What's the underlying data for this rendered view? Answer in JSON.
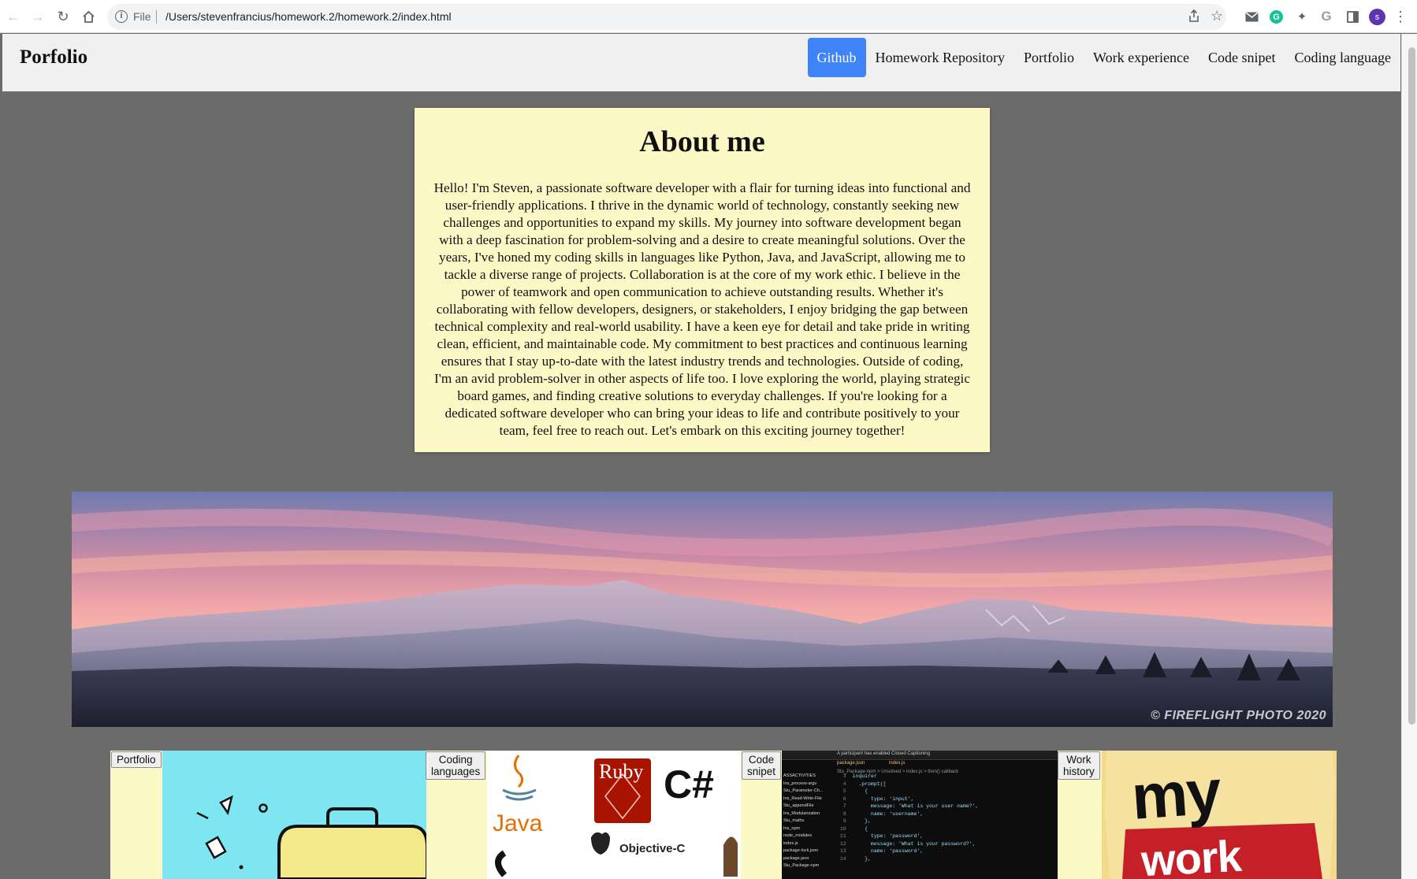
{
  "browser": {
    "file_label": "File",
    "url": "/Users/stevenfrancius/homework.2/homework.2/index.html",
    "avatar_letter": "s",
    "icons": [
      "back-arrow-icon",
      "forward-arrow-icon",
      "reload-icon",
      "home-icon",
      "info-icon",
      "share-icon",
      "star-icon",
      "mail-icon",
      "grammarly-icon",
      "puzzle-icon",
      "google-icon",
      "sidebar-icon",
      "menu-dots-icon"
    ]
  },
  "header": {
    "brand": "Porfolio",
    "nav": [
      {
        "label": "Github",
        "active": true
      },
      {
        "label": "Homework Repository",
        "active": false
      },
      {
        "label": "Portfolio",
        "active": false
      },
      {
        "label": "Work experience",
        "active": false
      },
      {
        "label": "Code snipet",
        "active": false
      },
      {
        "label": "Coding language",
        "active": false
      }
    ],
    "active_color": "#3f83f8"
  },
  "about": {
    "title": "About me",
    "body": "Hello! I'm Steven, a passionate software developer with a flair for turning ideas into functional and user-friendly applications. I thrive in the dynamic world of technology, constantly seeking new challenges and opportunities to expand my skills. My journey into software development began with a deep fascination for problem-solving and a desire to create meaningful solutions. Over the years, I've honed my coding skills in languages like Python, Java, and JavaScript, allowing me to tackle a diverse range of projects. Collaboration is at the core of my work ethic. I believe in the power of teamwork and open communication to achieve outstanding results. Whether it's collaborating with fellow developers, designers, or stakeholders, I enjoy bridging the gap between technical complexity and real-world usability. I have a keen eye for detail and take pride in writing clean, efficient, and maintainable code. My commitment to best practices and continuous learning ensures that I stay up-to-date with the latest industry trends and technologies. Outside of coding, I'm an avid problem-solver in other aspects of life too. I love exploring the world, playing strategic board games, and finding creative solutions to everyday challenges. If you're looking for a dedicated software developer who can bring your ideas to life and contribute positively to your team, feel free to reach out. Let's embark on this exciting journey together!",
    "background": "#fdf9c6"
  },
  "banner": {
    "watermark": "© FIREFLIGHT PHOTO 2020"
  },
  "gallery": {
    "tiles": [
      {
        "button": "Portfolio"
      },
      {
        "button": "Coding\nlanguages"
      },
      {
        "button": "Code\nsnipet"
      },
      {
        "button": "Work\nhistory"
      }
    ],
    "languages": {
      "java": "Java",
      "ruby": "Ruby",
      "csharp": "C#",
      "objc": "Objective-C"
    },
    "code_tabs": {
      "notice": "A participant has enabled Closed Captioning",
      "tab1": "package.json",
      "tab2": "index.js",
      "crumb": "Stu_Package-npm > Unsolved > index.js > then() callback"
    },
    "code_files": [
      "ASSACTIVITIES",
      "Ins_process-argv",
      "Stu_Parameter-Ch...",
      "Ins_Read-Write-File",
      "Stu_appendFile",
      "Ins_Modularization",
      "Stu_maths",
      "Ins_npm",
      "node_modules",
      "index.js",
      "package-lock.json",
      "package.json",
      "Stu_Package-npm"
    ],
    "code_lines": [
      "inquirer",
      "  .prompt([",
      "    {",
      "      type: 'input',",
      "      message: 'What is your user name?',",
      "      name: 'username',",
      "    },",
      "    {",
      "      type: 'password',",
      "      message: 'What is your password?',",
      "      name: 'password',",
      "    },"
    ],
    "work_text": [
      "my",
      "work"
    ]
  }
}
